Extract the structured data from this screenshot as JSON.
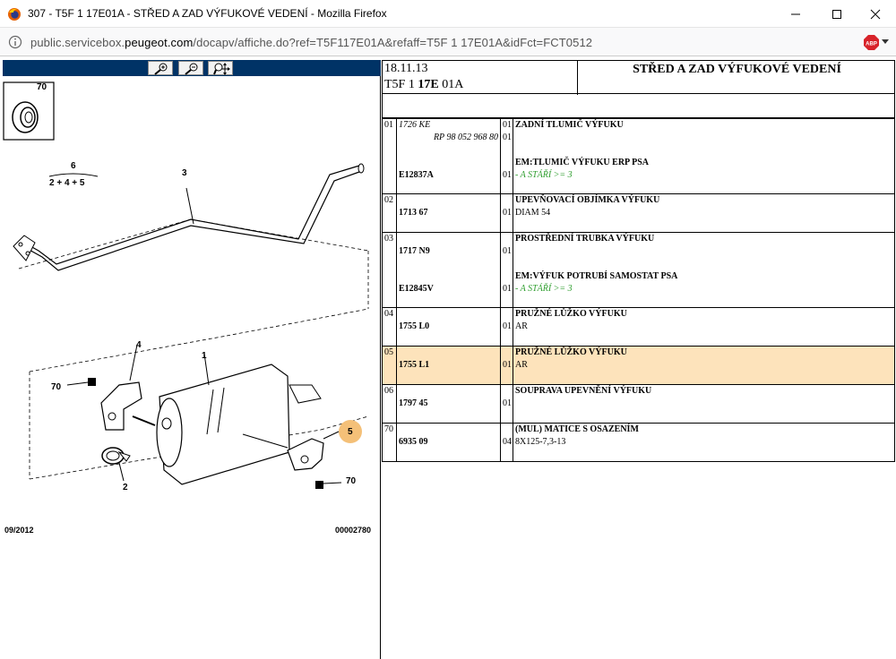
{
  "window": {
    "title": "307 - T5F 1 17E01A - STŘED A ZAD VÝFUKOVÉ VEDENÍ - Mozilla Firefox",
    "url_pre": "public.servicebox.",
    "url_domain": "peugeot.com",
    "url_post": "/docapv/affiche.do?ref=T5F117E01A&refaff=T5F 1 17E01A&idFct=FCT0512"
  },
  "diagram": {
    "inset_label": "70",
    "sum_top": "6",
    "sum_bottom": "2 + 4 + 5",
    "callouts": [
      "3",
      "4",
      "70",
      "1",
      "5",
      "2",
      "70"
    ],
    "footer_date": "09/2012",
    "footer_ref": "00002780"
  },
  "header": {
    "date": "18.11.13",
    "code_a": "T5F 1 ",
    "code_b": "17E",
    "code_c": " 01A",
    "title": "STŘED A ZAD VÝFUKOVÉ VEDENÍ"
  },
  "parts": [
    {
      "no": "01",
      "lines": [
        {
          "ref": "1726 KE",
          "ref_style": "it",
          "qty": "01",
          "desc": "ZADNÍ TLUMIČ VÝFUKU",
          "desc_style": "bd"
        },
        {
          "ref": "RP 98 052 968 80",
          "ref_style": "it",
          "ref_right": true,
          "qty": "01",
          "desc": "",
          "desc_style": ""
        },
        {
          "ref": "",
          "ref_style": "",
          "qty": "",
          "desc": "EM:TLUMIČ VÝFUKU ERP PSA",
          "desc_style": "bd"
        },
        {
          "ref": "E12837A",
          "ref_style": "bd",
          "qty": "01",
          "desc": "- A STÁŘÍ >= 3",
          "desc_style": "gr"
        }
      ]
    },
    {
      "no": "02",
      "lines": [
        {
          "ref": "",
          "ref_style": "",
          "qty": "",
          "desc": "UPEVŇOVACÍ OBJÍMKA VÝFUKU",
          "desc_style": "bd"
        },
        {
          "ref": "1713 67",
          "ref_style": "bd",
          "qty": "01",
          "desc": "DIAM 54",
          "desc_style": ""
        }
      ]
    },
    {
      "no": "03",
      "lines": [
        {
          "ref": "",
          "ref_style": "",
          "qty": "",
          "desc": "PROSTŘEDNÍ TRUBKA VÝFUKU",
          "desc_style": "bd"
        },
        {
          "ref": "1717 N9",
          "ref_style": "bd",
          "qty": "01",
          "desc": "",
          "desc_style": ""
        },
        {
          "ref": "",
          "ref_style": "",
          "qty": "",
          "desc": "EM:VÝFUK POTRUBÍ SAMOSTAT PSA",
          "desc_style": "bd"
        },
        {
          "ref": "E12845V",
          "ref_style": "bd",
          "qty": "01",
          "desc": "- A STÁŘÍ >= 3",
          "desc_style": "gr"
        }
      ]
    },
    {
      "no": "04",
      "lines": [
        {
          "ref": "",
          "ref_style": "",
          "qty": "",
          "desc": "PRUŽNÉ LŮŽKO VÝFUKU",
          "desc_style": "bd"
        },
        {
          "ref": "1755 L0",
          "ref_style": "bd",
          "qty": "01",
          "desc": "AR",
          "desc_style": ""
        }
      ]
    },
    {
      "no": "05",
      "highlight": true,
      "lines": [
        {
          "ref": "",
          "ref_style": "",
          "qty": "",
          "desc": "PRUŽNÉ LŮŽKO VÝFUKU",
          "desc_style": "bd"
        },
        {
          "ref": "1755 L1",
          "ref_style": "bd",
          "qty": "01",
          "desc": "AR",
          "desc_style": ""
        }
      ]
    },
    {
      "no": "06",
      "lines": [
        {
          "ref": "",
          "ref_style": "",
          "qty": "",
          "desc": "SOUPRAVA UPEVNĚNÍ VÝFUKU",
          "desc_style": "bd"
        },
        {
          "ref": "1797 45",
          "ref_style": "bd",
          "qty": "01",
          "desc": "",
          "desc_style": ""
        }
      ]
    },
    {
      "no": "70",
      "lines": [
        {
          "ref": "",
          "ref_style": "",
          "qty": "",
          "desc": "(MUL) MATICE S OSAZENÍM",
          "desc_style": "bd"
        },
        {
          "ref": "6935 09",
          "ref_style": "bd",
          "qty": "04",
          "desc": "8X125-7,3-13",
          "desc_style": ""
        }
      ]
    }
  ]
}
